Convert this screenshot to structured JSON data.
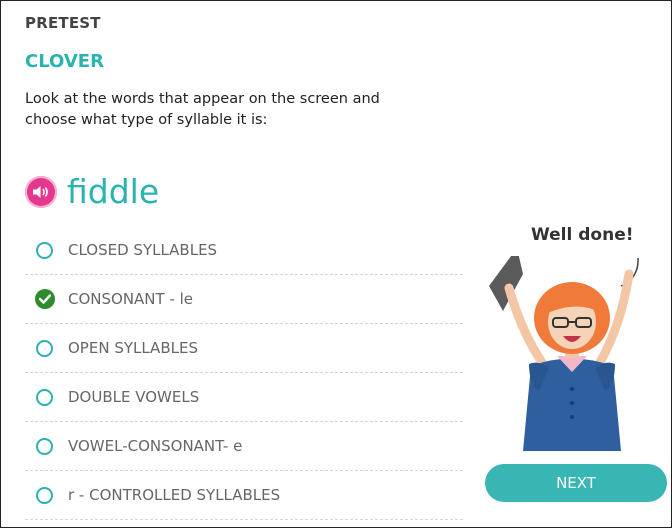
{
  "header": {
    "section_label": "PRETEST",
    "title": "CLOVER"
  },
  "question": {
    "instructions": "Look at the words that appear on the screen and choose what type of syllable it is:",
    "word": "fiddle"
  },
  "options": [
    {
      "label": "CLOSED SYLLABLES",
      "selected": false
    },
    {
      "label": "CONSONANT - le",
      "selected": true
    },
    {
      "label": "OPEN SYLLABLES",
      "selected": false
    },
    {
      "label": "DOUBLE VOWELS",
      "selected": false
    },
    {
      "label": "VOWEL-CONSONANT- e",
      "selected": false
    },
    {
      "label": "r - CONTROLLED SYLLABLES",
      "selected": false
    }
  ],
  "feedback": {
    "message": "Well done!"
  },
  "buttons": {
    "next_label": "NEXT"
  },
  "colors": {
    "accent": "#2bb3b1",
    "speaker": "#e6378f",
    "correct": "#2e8b2e",
    "next_button": "#38b6b4"
  },
  "icons": {
    "speaker": "speaker-icon",
    "correct": "check-icon"
  }
}
